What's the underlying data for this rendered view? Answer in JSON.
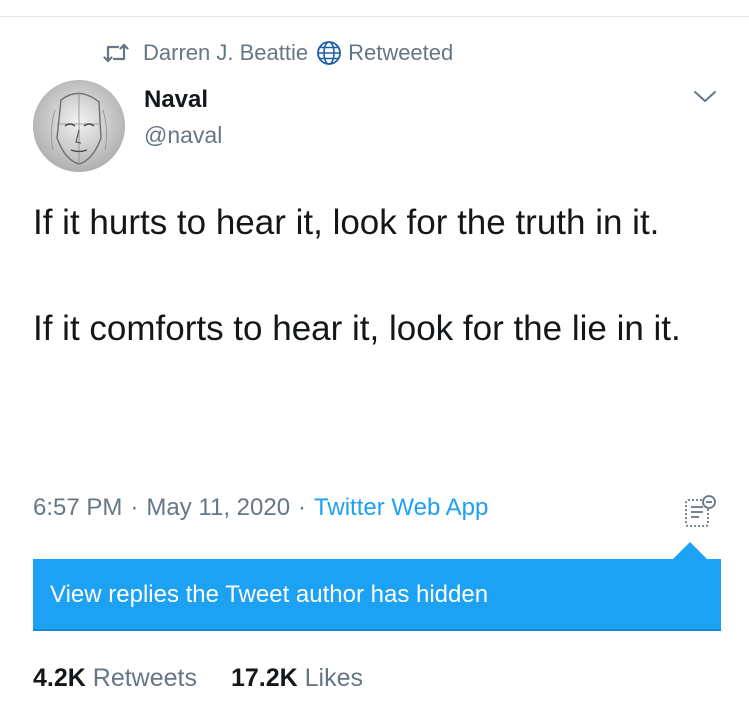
{
  "retweet_notice": {
    "retweeter": "Darren J. Beattie",
    "action": "Retweeted",
    "icon": "retweet-icon",
    "badge_icon": "globe-icon"
  },
  "author": {
    "name": "Naval",
    "handle": "@naval",
    "avatar_icon": "avatar-sketch-face",
    "menu_icon": "chevron-down-icon"
  },
  "tweet": {
    "paragraphs": [
      "If it hurts to hear it, look for the truth in it.",
      "If it comforts to hear it, look for the lie in it."
    ]
  },
  "meta": {
    "time": "6:57 PM",
    "separator": "·",
    "date": "May 11, 2020",
    "source": "Twitter Web App",
    "analytics_icon": "tweet-analytics-icon"
  },
  "hidden_replies": {
    "label": "View replies the Tweet author has hidden"
  },
  "stats": {
    "retweets_count": "4.2K",
    "retweets_label": "Retweets",
    "likes_count": "17.2K",
    "likes_label": "Likes"
  },
  "colors": {
    "accent": "#1da1f2",
    "secondary_text": "#657786",
    "primary_text": "#14171a",
    "divider": "#e1e8ed"
  }
}
